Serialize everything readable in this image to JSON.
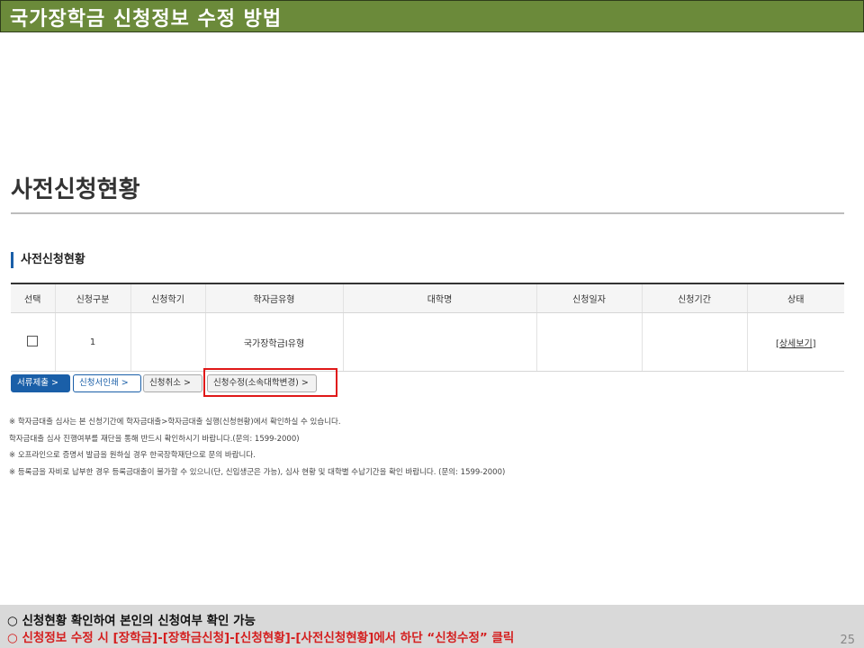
{
  "slide": {
    "title": "국가장학금 신청정보 수정 방법",
    "page_number": "25"
  },
  "page": {
    "heading": "사전신청현황",
    "section_title": "사전신청현황"
  },
  "table": {
    "headers": [
      "선택",
      "신청구분",
      "신청학기",
      "학자금유형",
      "대학명",
      "신청일자",
      "신청기간",
      "상태"
    ],
    "rows": [
      {
        "select": "",
        "category": "1",
        "semester": "",
        "type": "국가장학금I유형",
        "university": "",
        "date": "",
        "period": "",
        "status": "[상세보기]"
      }
    ]
  },
  "buttons": {
    "submit": "서류제출 >",
    "print": "신청서인쇄 >",
    "cancel": "신청취소 >",
    "edit": "신청수정(소속대학변경) >"
  },
  "notes": [
    "※ 학자금대출 심사는 본 신청기간에 학자금대출>학자금대출 실행(신청현황)에서 확인하실 수 있습니다.",
    "   학자금대출 심사 진행여부를 재단을 통해 반드시 확인하시기 바랍니다.(문의: 1599-2000)",
    "※ 오프라인으로 증명서 발급을 원하실 경우 한국장학재단으로 문의 바랍니다.",
    "※ 등록금을 자비로 납부한 경우 등록금대출이 불가할 수 있으니(단, 신입생군은 가능), 심사 현황 및 대학별 수납기간을 확인 바랍니다. (문의: 1599-2000)"
  ],
  "footer": {
    "line1": "○ 신청현황 확인하여 본인의 신청여부 확인 가능",
    "line2": "○ 신청정보 수정 시 [장학금]-[장학금신청]-[신청현황]-[사전신청현황]에서 하단 “신청수정” 클릭"
  },
  "colors": {
    "title_bar": "#6b8a3a",
    "accent_blue": "#1a5fa8",
    "highlight_red": "#e01818",
    "footer_red": "#d42020"
  }
}
